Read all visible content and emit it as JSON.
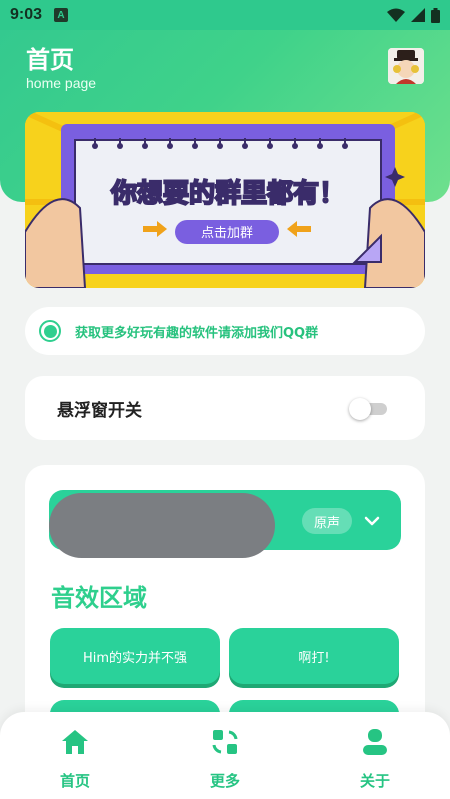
{
  "status_bar": {
    "time": "9:03",
    "notification_icon": "a-badge-icon",
    "icons": [
      "wifi-icon",
      "signal-icon",
      "battery-icon"
    ]
  },
  "header": {
    "title": "首页",
    "subtitle": "home page",
    "avatar_icon": "avatar"
  },
  "banner": {
    "headline": "你想要的群里都有！",
    "button_label": "点击加群"
  },
  "notice": {
    "text": "获取更多好玩有趣的软件请添加我们QQ群"
  },
  "floating_window": {
    "label": "悬浮窗开关",
    "enabled": false
  },
  "sound_panel": {
    "selected_voice": "原声",
    "section_title": "音效区域",
    "buttons": [
      {
        "label": "Him的实力并不强"
      },
      {
        "label": "啊打!"
      },
      {
        "label": ""
      },
      {
        "label": ""
      }
    ]
  },
  "bottom_nav": {
    "items": [
      {
        "label": "首页",
        "icon": "home-icon"
      },
      {
        "label": "更多",
        "icon": "more-icon"
      },
      {
        "label": "关于",
        "icon": "user-icon"
      }
    ]
  },
  "colors": {
    "primary": "#2ad29a",
    "accent_text": "#2ecf8d",
    "banner_yellow": "#f7d21c",
    "banner_purple": "#7a5fe0"
  }
}
